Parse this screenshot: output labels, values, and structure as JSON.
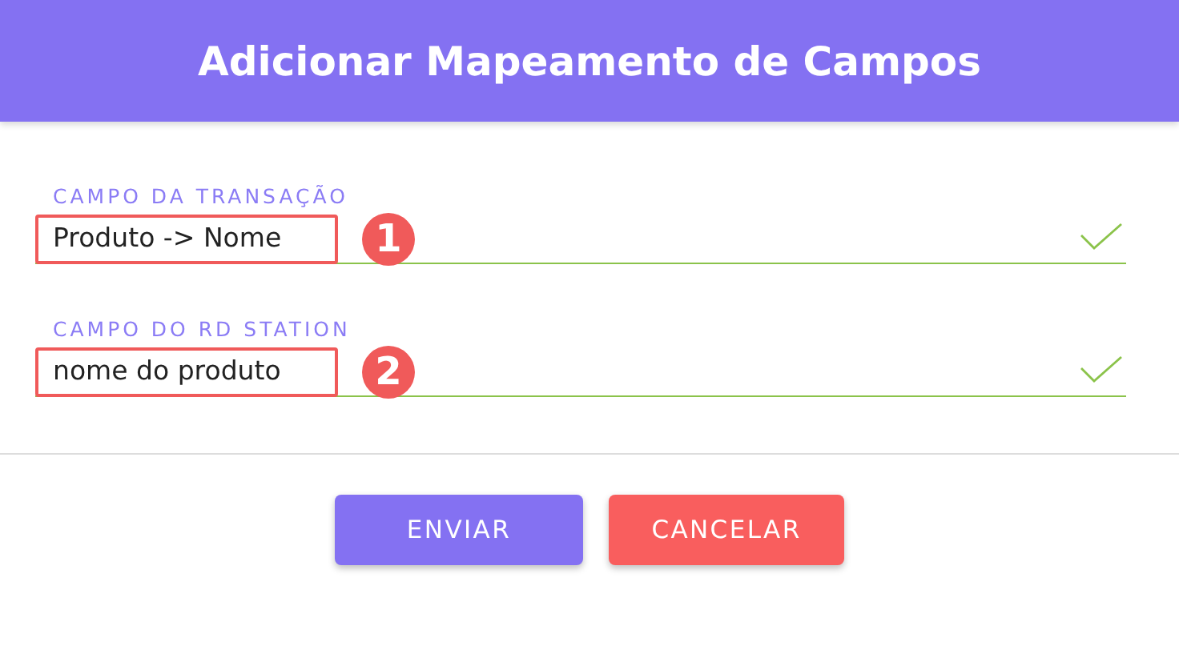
{
  "dialog": {
    "title": "Adicionar Mapeamento de Campos"
  },
  "fields": [
    {
      "label": "CAMPO DA TRANSAÇÃO",
      "value": "Produto -> Nome",
      "valid": true,
      "marker": "1"
    },
    {
      "label": "CAMPO DO RD STATION",
      "value": "nome do produto",
      "valid": true,
      "marker": "2"
    }
  ],
  "buttons": [
    {
      "label": "ENVIAR",
      "kind": "primary"
    },
    {
      "label": "CANCELAR",
      "kind": "danger"
    }
  ]
}
